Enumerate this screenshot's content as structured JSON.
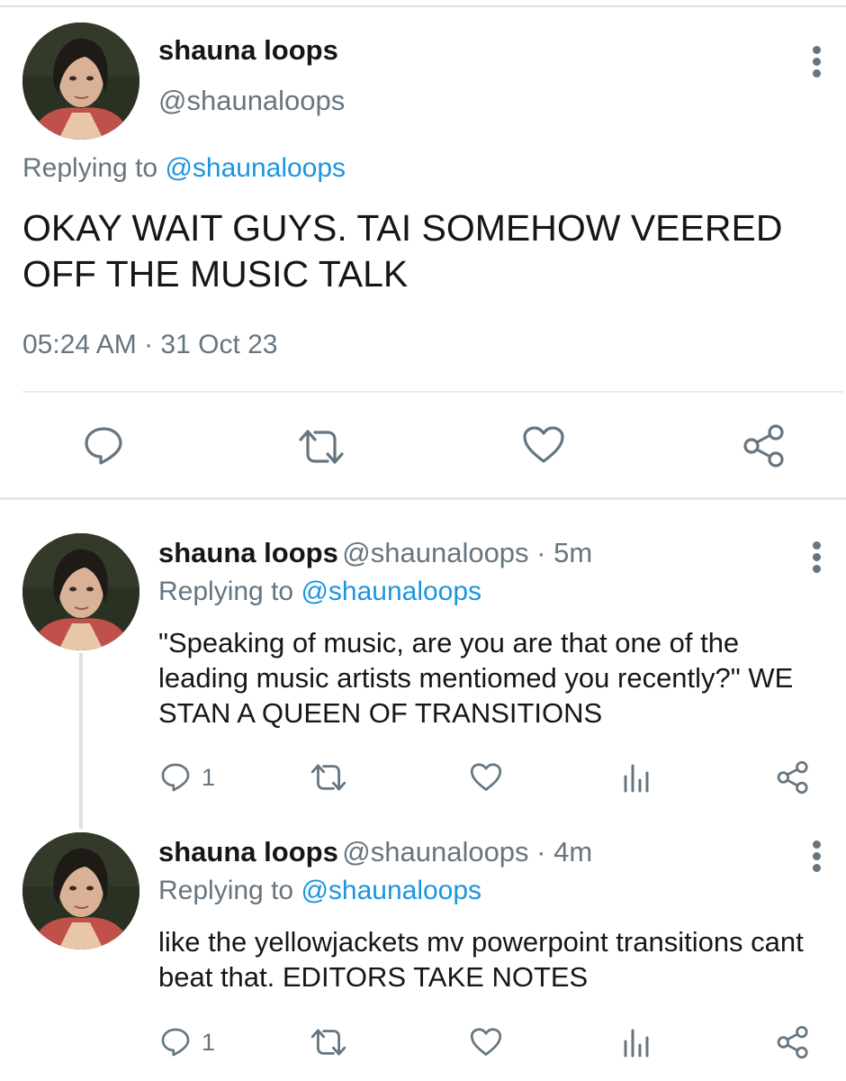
{
  "main_tweet": {
    "name": "shauna loops",
    "handle": "@shaunaloops",
    "replying_prefix": "Replying to ",
    "replying_handle": "@shaunaloops",
    "text": "OKAY WAIT GUYS. TAI SOMEHOW VEERED OFF THE MUSIC TALK",
    "timestamp": "05:24 AM · 31 Oct 23",
    "icons": [
      "reply-icon",
      "retweet-icon",
      "like-icon",
      "share-icon"
    ]
  },
  "replies": [
    {
      "name": "shauna loops",
      "handle_time": "@shaunaloops · 5m",
      "replying_prefix": "Replying to ",
      "replying_handle": "@shaunaloops",
      "text": "\"Speaking of music, are you are that one of the leading music artists mentiomed you recently?\" WE STAN A QUEEN OF TRANSITIONS",
      "reply_count": "1"
    },
    {
      "name": "shauna loops",
      "handle_time": "@shaunaloops · 4m",
      "replying_prefix": "Replying to ",
      "replying_handle": "@shaunaloops",
      "text": "like the yellowjackets mv powerpoint transitions cant beat that. EDITORS TAKE NOTES",
      "reply_count": "1"
    }
  ],
  "colors": {
    "text": "#14171a",
    "secondary": "#66757f",
    "link": "#1b95e0",
    "divider": "#e6ecf0"
  }
}
